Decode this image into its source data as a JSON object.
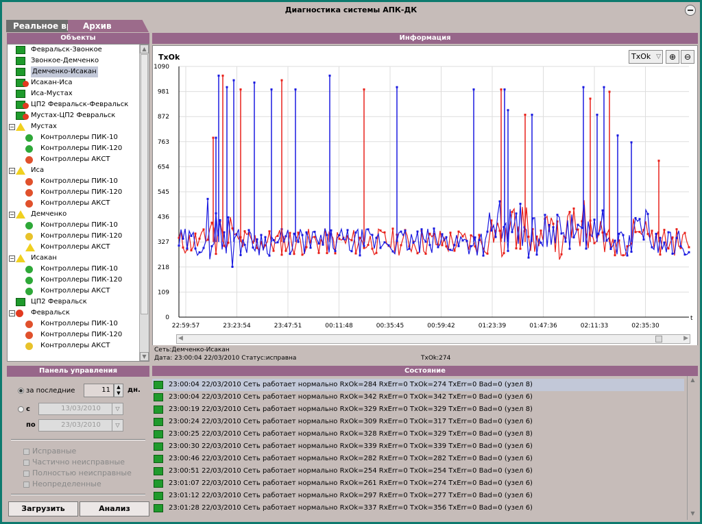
{
  "window": {
    "title": "Диагностика системы АПК-ДК"
  },
  "tabs": [
    {
      "label": "Реальное вр"
    },
    {
      "label": "Архив"
    }
  ],
  "objects": {
    "header": "Объекты",
    "items": [
      {
        "label": "Февральск-Звонкое",
        "icon": "pc-icon",
        "level": 0
      },
      {
        "label": "Звонкое-Демченко",
        "icon": "pc-icon",
        "level": 0
      },
      {
        "label": "Демченко-Исакан",
        "icon": "pc-icon",
        "level": 0,
        "selected": true
      },
      {
        "label": "Исакан-Иса",
        "icon": "pc-error-icon",
        "level": 0
      },
      {
        "label": "Иса-Мустах",
        "icon": "pc-icon",
        "level": 0
      },
      {
        "label": "ЦП2 Февральск-Февральск",
        "icon": "pc-error-icon",
        "level": 0
      },
      {
        "label": "Мустах-ЦП2 Февральск",
        "icon": "pc-error-icon",
        "level": 0
      },
      {
        "label": "Мустах",
        "icon": "warning-icon",
        "level": 0,
        "expand": true
      },
      {
        "label": "Контроллеры ПИК-10",
        "icon": "gear-green-icon",
        "level": 1
      },
      {
        "label": "Контроллеры ПИК-120",
        "icon": "gear-green-icon",
        "level": 1
      },
      {
        "label": "Контроллеры АКСТ",
        "icon": "gear-red-icon",
        "level": 1
      },
      {
        "label": "Иса",
        "icon": "warning-icon",
        "level": 0,
        "expand": true
      },
      {
        "label": "Контроллеры ПИК-10",
        "icon": "gear-red-icon",
        "level": 1
      },
      {
        "label": "Контроллеры ПИК-120",
        "icon": "gear-red-icon",
        "level": 1
      },
      {
        "label": "Контроллеры АКСТ",
        "icon": "gear-red-icon",
        "level": 1
      },
      {
        "label": "Демченко",
        "icon": "warning-icon",
        "level": 0,
        "expand": true
      },
      {
        "label": "Контроллеры ПИК-10",
        "icon": "gear-green-icon",
        "level": 1
      },
      {
        "label": "Контроллеры ПИК-120",
        "icon": "gear-yellow-icon",
        "level": 1
      },
      {
        "label": "Контроллеры АКСТ",
        "icon": "warning-icon",
        "level": 1
      },
      {
        "label": "Исакан",
        "icon": "warning-icon",
        "level": 0,
        "expand": true
      },
      {
        "label": "Контроллеры ПИК-10",
        "icon": "gear-green-icon",
        "level": 1
      },
      {
        "label": "Контроллеры ПИК-120",
        "icon": "gear-green-icon",
        "level": 1
      },
      {
        "label": "Контроллеры АКСТ",
        "icon": "gear-green-icon",
        "level": 1
      },
      {
        "label": "ЦП2 Февральск",
        "icon": "pc-icon",
        "level": 0
      },
      {
        "label": "Февральск",
        "icon": "error-icon",
        "level": 0,
        "expand": true
      },
      {
        "label": "Контроллеры ПИК-10",
        "icon": "gear-red-icon",
        "level": 1
      },
      {
        "label": "Контроллеры ПИК-120",
        "icon": "gear-red-icon",
        "level": 1
      },
      {
        "label": "Контроллеры АКСТ",
        "icon": "gear-yellow-icon",
        "level": 1
      }
    ]
  },
  "info": {
    "header": "Информация",
    "series_selector": "TxOk",
    "net_line": "Сеть:Демченко-Исакан",
    "date_line": "Дата: 23:00:04  22/03/2010  Статус:исправна",
    "value_line": "TxOk:274"
  },
  "chart_data": {
    "type": "line",
    "title": "TxOk",
    "x_axis_end_label": "t",
    "yticks": [
      "0",
      "109",
      "218",
      "327",
      "436",
      "545",
      "654",
      "763",
      "872",
      "981",
      "1090"
    ],
    "xticks": [
      "22:59:57",
      "23:23:54",
      "23:47:51",
      "00:11:48",
      "00:35:45",
      "00:59:42",
      "01:23:39",
      "01:47:36",
      "02:11:33",
      "02:35:30"
    ],
    "ylim": [
      0,
      1090
    ],
    "colors": {
      "red": "#e8201a",
      "blue": "#1a1ae0"
    }
  },
  "control": {
    "header": "Панель управления",
    "last_label": "за последние",
    "days_value": "11",
    "days_unit": "дн.",
    "from_label": "с",
    "from_date": "13/03/2010",
    "to_label": "по",
    "to_date": "23/03/2010",
    "checks": [
      "Исправные",
      "Частично неисправные",
      "Полностью неисправные",
      "Неопределенные"
    ],
    "load_button": "Загрузить",
    "analysis_button": "Анализ"
  },
  "state": {
    "header": "Состояние",
    "rows": [
      "23:00:04  22/03/2010   Сеть работает нормально  RxOk=284 RxErr=0 TxOk=274 TxErr=0 Bad=0 (узел 8)",
      "23:00:04  22/03/2010   Сеть работает нормально  RxOk=342 RxErr=0 TxOk=342 TxErr=0 Bad=0 (узел 6)",
      "23:00:19  22/03/2010   Сеть работает нормально  RxOk=329 RxErr=0 TxOk=329 TxErr=0 Bad=0 (узел 8)",
      "23:00:24  22/03/2010   Сеть работает нормально  RxOk=309 RxErr=0 TxOk=317 TxErr=0 Bad=0 (узел 6)",
      "23:00:25  22/03/2010   Сеть работает нормально  RxOk=328 RxErr=0 TxOk=329 TxErr=0 Bad=0 (узел 8)",
      "23:00:30  22/03/2010   Сеть работает нормально  RxOk=339 RxErr=0 TxOk=339 TxErr=0 Bad=0 (узел 6)",
      "23:00:46  22/03/2010   Сеть работает нормально  RxOk=282 RxErr=0 TxOk=282 TxErr=0 Bad=0 (узел 6)",
      "23:00:51  22/03/2010   Сеть работает нормально  RxOk=254 RxErr=0 TxOk=254 TxErr=0 Bad=0 (узел 6)",
      "23:01:07  22/03/2010   Сеть работает нормально  RxOk=261 RxErr=0 TxOk=274 TxErr=0 Bad=0 (узел 6)",
      "23:01:12  22/03/2010   Сеть работает нормально  RxOk=297 RxErr=0 TxOk=277 TxErr=0 Bad=0 (узел 6)",
      "23:01:28  22/03/2010   Сеть работает нормально  RxOk=337 RxErr=0 TxOk=356 TxErr=0 Bad=0 (узел 6)"
    ]
  }
}
